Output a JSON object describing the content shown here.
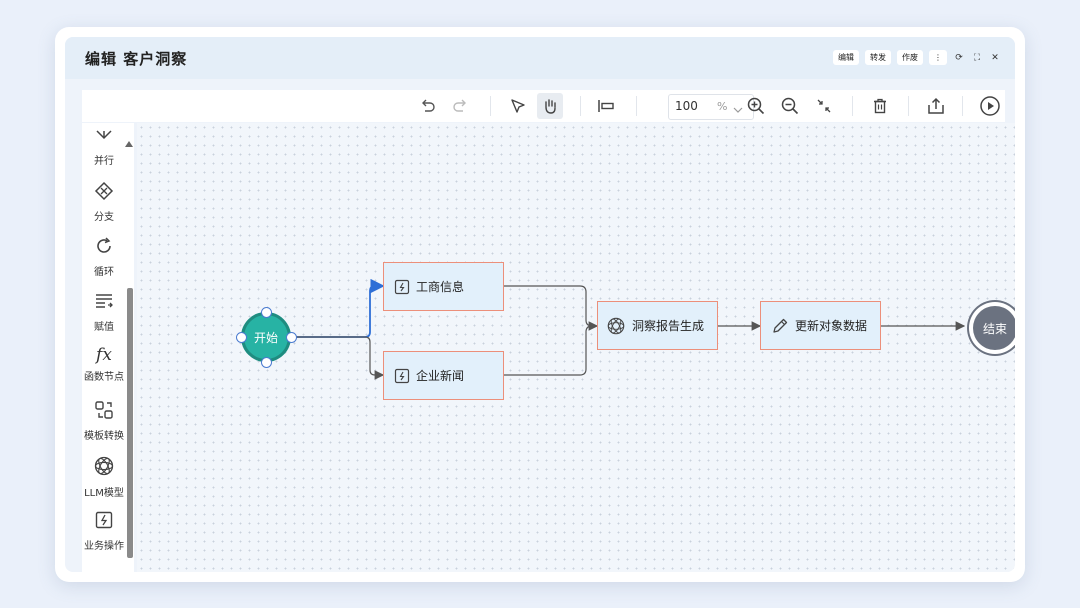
{
  "window": {
    "title": "编辑  客户洞察",
    "title_actions": [
      "编辑",
      "转发",
      "作废"
    ],
    "window_controls": [
      "more-icon",
      "refresh-icon",
      "expand-icon",
      "close-icon"
    ]
  },
  "toolbar": {
    "zoom_value": "100",
    "zoom_unit": "%",
    "tools": [
      "undo-icon",
      "redo-icon",
      "pointer-icon",
      "hand-icon",
      "align-icon",
      "zoom-in-icon",
      "zoom-out-icon",
      "fit-icon",
      "delete-icon",
      "export-icon",
      "run-icon"
    ]
  },
  "sidebar": {
    "items": [
      {
        "label": "并行",
        "icon": "parallel-icon"
      },
      {
        "label": "分支",
        "icon": "branch-icon"
      },
      {
        "label": "循环",
        "icon": "loop-icon"
      },
      {
        "label": "赋值",
        "icon": "assign-icon"
      },
      {
        "label": "函数节点",
        "icon": "function-icon"
      },
      {
        "label": "模板转换",
        "icon": "template-icon"
      },
      {
        "label": "LLM模型",
        "icon": "llm-icon"
      },
      {
        "label": "业务操作",
        "icon": "business-icon"
      }
    ]
  },
  "flow": {
    "start": "开始",
    "nodes": [
      {
        "id": "n1",
        "label": "工商信息",
        "icon": "action-icon"
      },
      {
        "id": "n2",
        "label": "企业新闻",
        "icon": "action-icon"
      },
      {
        "id": "n3",
        "label": "洞察报告生成",
        "icon": "llm-icon"
      },
      {
        "id": "n4",
        "label": "更新对象数据",
        "icon": "edit-icon"
      }
    ],
    "end": "结束"
  },
  "colors": {
    "accent": "#2f6fd6",
    "start_fill": "#27b3a4",
    "node_border": "#ec8f7a",
    "node_fill": "#e2f0fb",
    "end_fill": "#6b7280"
  }
}
